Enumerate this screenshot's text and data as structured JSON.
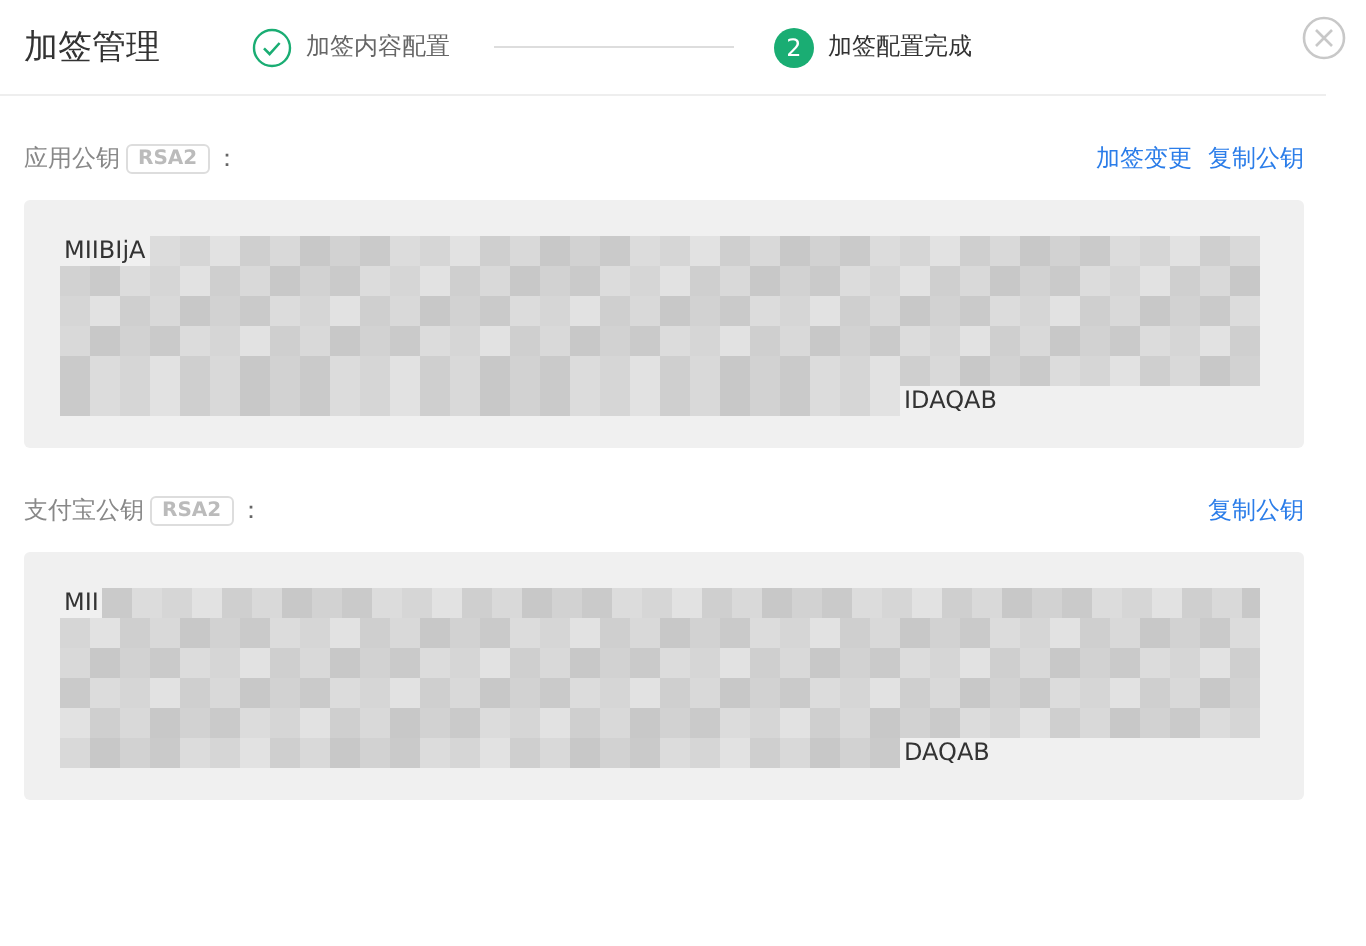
{
  "header": {
    "title": "加签管理",
    "steps": [
      {
        "kind": "check",
        "label": "加签内容配置",
        "selected": false
      },
      {
        "kind": "number",
        "number": "2",
        "label": "加签配置完成",
        "selected": true
      }
    ]
  },
  "sections": [
    {
      "label": "应用公钥",
      "badge": "RSA2",
      "colon": "：",
      "links": [
        "加签变更",
        "复制公钥"
      ],
      "key_start": "MIIBIjA",
      "key_end": "IDAQAB"
    },
    {
      "label": "支付宝公钥",
      "badge": "RSA2",
      "colon": "：",
      "links": [
        "复制公钥"
      ],
      "key_start": "MII",
      "key_end": "DAQAB"
    }
  ]
}
